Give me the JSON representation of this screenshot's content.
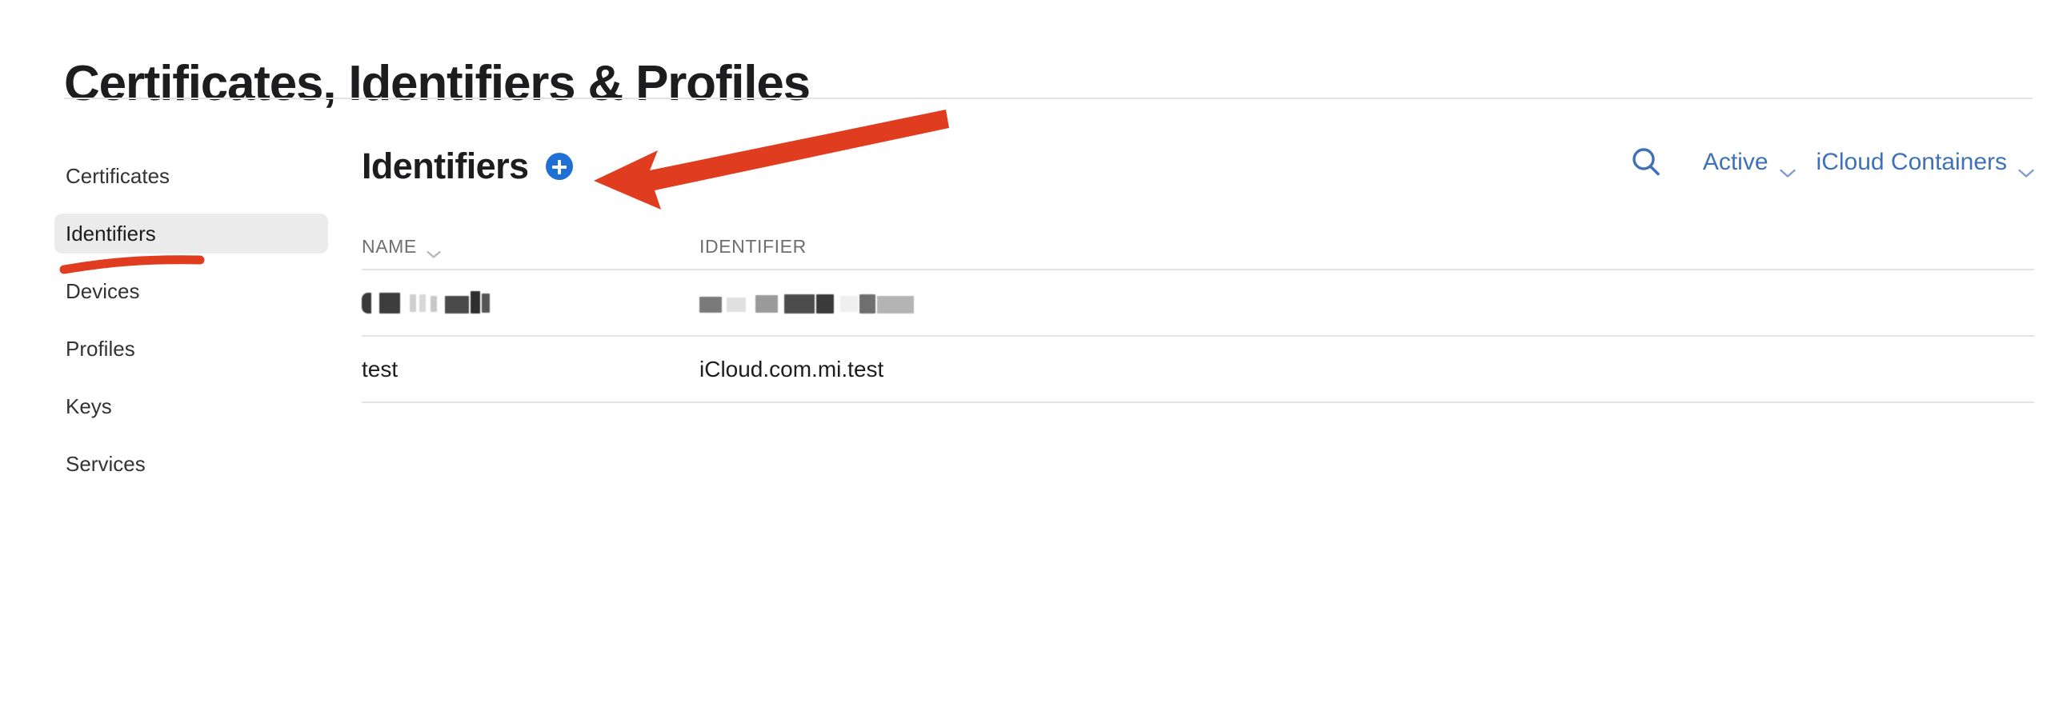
{
  "page": {
    "title": "Certificates, Identifiers & Profiles"
  },
  "sidebar": {
    "items": [
      {
        "label": "Certificates",
        "selected": false
      },
      {
        "label": "Identifiers",
        "selected": true
      },
      {
        "label": "Devices",
        "selected": false
      },
      {
        "label": "Profiles",
        "selected": false
      },
      {
        "label": "Keys",
        "selected": false
      },
      {
        "label": "Services",
        "selected": false
      }
    ]
  },
  "main": {
    "section_title": "Identifiers",
    "add_button_label": "+",
    "tools": {
      "search_icon": "search-icon",
      "status_filter": {
        "label": "Active",
        "chevron": "chevron-down-icon"
      },
      "type_filter": {
        "label": "iCloud Containers",
        "chevron": "chevron-down-icon"
      }
    },
    "table": {
      "columns": [
        {
          "label": "NAME",
          "sortable": true,
          "chevron": "chevron-down-icon"
        },
        {
          "label": "IDENTIFIER",
          "sortable": false
        }
      ],
      "rows": [
        {
          "name": "",
          "identifier": "",
          "redacted": true
        },
        {
          "name": "test",
          "identifier": "iCloud.com.mi.test",
          "redacted": false
        }
      ]
    }
  },
  "annotations": {
    "arrow": {
      "color": "#e03c1f",
      "points_to": "add-identifier-button"
    },
    "underline": {
      "color": "#e03c1f",
      "underlines": "sidebar-item-identifiers"
    }
  },
  "colors": {
    "accent_blue": "#1f6fd4",
    "link_blue": "#3f71b8",
    "annotation_red": "#e03c1f",
    "selected_bg": "#ebebeb",
    "rule": "#e3e3e3",
    "header_text": "#6e6e73"
  }
}
